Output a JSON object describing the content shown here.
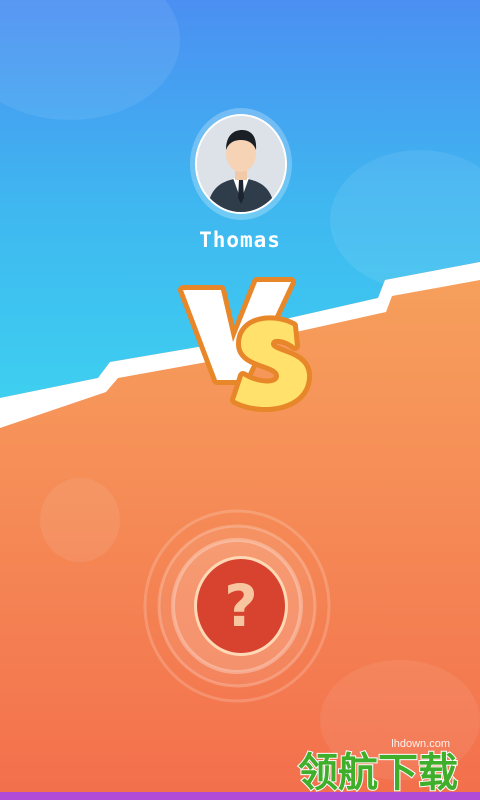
{
  "player": {
    "name": "Thomas",
    "avatar_icon": "businessman-avatar-icon"
  },
  "vs": {
    "text_v": "V",
    "text_s": "S",
    "v_color": "#ffffff",
    "s_color": "#ffe16b",
    "outline_color": "#e8862a"
  },
  "opponent": {
    "placeholder_icon": "question-mark-icon",
    "symbol": "?"
  },
  "watermark": {
    "url": "lhdown.com",
    "logo_text": "领航下载"
  },
  "colors": {
    "sky_top": "#4aa6f0",
    "sky_bottom": "#3ec7ee",
    "sand_top": "#f7b35f",
    "sand_bottom": "#f47a4a",
    "button_red": "#d8432f",
    "watermark_green": "#3fae2a"
  }
}
